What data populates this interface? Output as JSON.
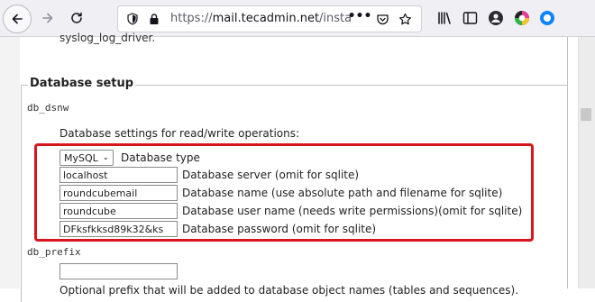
{
  "browser": {
    "url": "https://mail.tecadmin.net/installer/index.php",
    "url_host": "mail.tecadmin.net",
    "url_prefix": "https://",
    "url_path": "/installer/in"
  },
  "page": {
    "syslog_text": "syslog_log_driver.",
    "section_title": "Database setup",
    "dsnw_label": "db_dsnw",
    "settings_text": "Database settings for read/write operations:",
    "db_type": {
      "selected": "MySQL",
      "label": "Database type"
    },
    "db_server": {
      "value": "localhost",
      "label": "Database server (omit for sqlite)"
    },
    "db_name": {
      "value": "roundcubemail",
      "label": "Database name (use absolute path and filename for sqlite)"
    },
    "db_user": {
      "value": "roundcube",
      "label": "Database user name (needs write permissions)(omit for sqlite)"
    },
    "db_password": {
      "value": "DFksfkksd89k32&ks",
      "label": "Database password (omit for sqlite)"
    },
    "prefix_label": "db_prefix",
    "prefix_value": "",
    "cut_text": "Optional prefix that will be added to database object names (tables and sequences)."
  },
  "colors": {
    "highlight": "#d8151d",
    "toolbar": "#f0f0f4"
  },
  "icons": [
    "back-arrow-icon",
    "forward-arrow-icon",
    "reload-icon",
    "shield-icon",
    "lock-icon",
    "more-icon",
    "pocket-icon",
    "star-icon",
    "library-icon",
    "sidebar-icon",
    "account-icon",
    "extension-icon",
    "sync-icon"
  ]
}
